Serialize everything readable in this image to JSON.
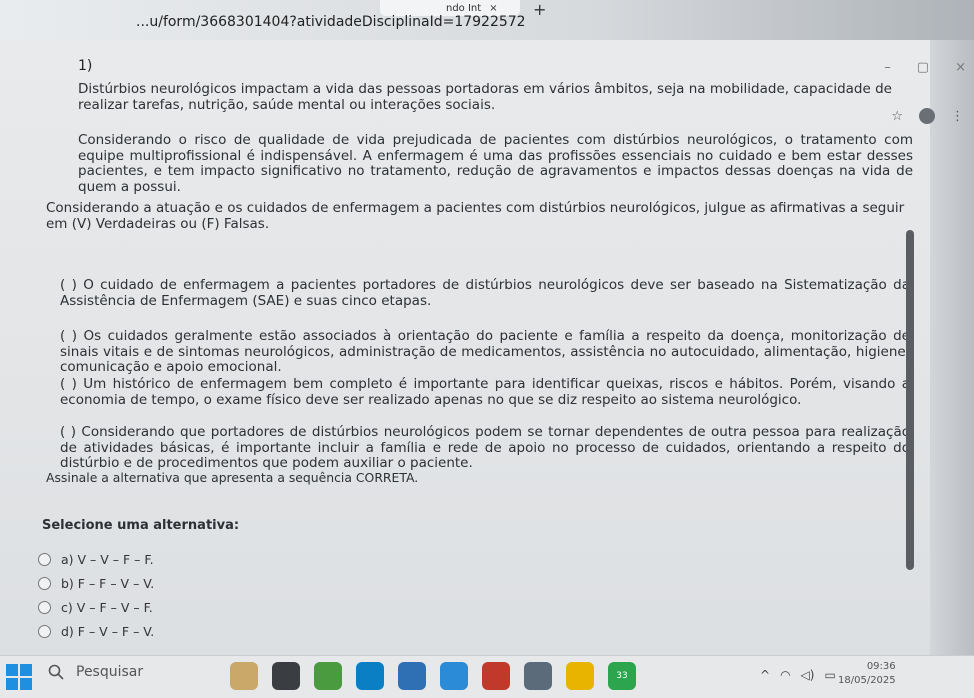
{
  "browser": {
    "tab_title": "ndo Int",
    "tab_close": "×",
    "new_tab": "+",
    "url": "...u/form/3668301404?atividadeDisciplinaId=17922572",
    "minimize": "–",
    "restore": "▢",
    "close": "×",
    "star": "☆",
    "menu": "⋮"
  },
  "question": {
    "number": "1)",
    "intro": "Distúrbios neurológicos impactam a vida das pessoas portadoras em vários âmbitos, seja na mobilidade, capacidade de realizar tarefas, nutrição, saúde mental ou interações sociais.",
    "considering": "Considerando o risco de qualidade de vida prejudicada de pacientes com distúrbios neurológicos, o tratamento com equipe multiprofissional é indispensável. A enfermagem é uma das profissões essenciais no cuidado e bem estar desses pacientes, e tem impacto significativo no tratamento, redução de agravamentos e impactos dessas doenças na vida de quem a possui.",
    "instruction": "Considerando a atuação e os cuidados de enfermagem a pacientes com distúrbios neurológicos, julgue as afirmativas a seguir em (V) Verdadeiras ou (F) Falsas.",
    "statements": [
      "(   ) O cuidado de enfermagem a pacientes portadores de distúrbios neurológicos deve ser baseado na Sistematização da Assistência de Enfermagem (SAE) e suas cinco etapas.",
      "(  ) Os cuidados geralmente estão associados à orientação do paciente e família a respeito da doença, monitorização de sinais vitais e de sintomas neurológicos, administração de medicamentos, assistência no autocuidado, alimentação, higiene, comunicação e apoio emocional.",
      "(   ) Um histórico de enfermagem bem completo é importante para identificar queixas, riscos e hábitos. Porém, visando a economia de tempo, o exame físico deve ser realizado apenas no que se diz respeito ao sistema neurológico.",
      "(  ) Considerando que portadores de distúrbios neurológicos podem se tornar dependentes de outra pessoa para realização de atividades básicas, é importante incluir a família e rede de apoio no processo de cuidados, orientando a respeito do distúrbio e de procedimentos que podem auxiliar o paciente."
    ],
    "assinale": "Assinale a alternativa que apresenta a sequência CORRETA.",
    "select_label": "Selecione uma alternativa:",
    "options": [
      "a) V – V – F – F.",
      "b) F – F – V – V.",
      "c) V – F – V – F.",
      "d) F – V – F – V."
    ]
  },
  "taskbar": {
    "search_placeholder": "Pesquisar",
    "time": "09:36",
    "date": "18/05/2025",
    "badge": "33"
  },
  "colors": {
    "start": "#1f8fe0",
    "chrome_icon": "#e8b400",
    "edge_icon": "#0a7fc4"
  }
}
